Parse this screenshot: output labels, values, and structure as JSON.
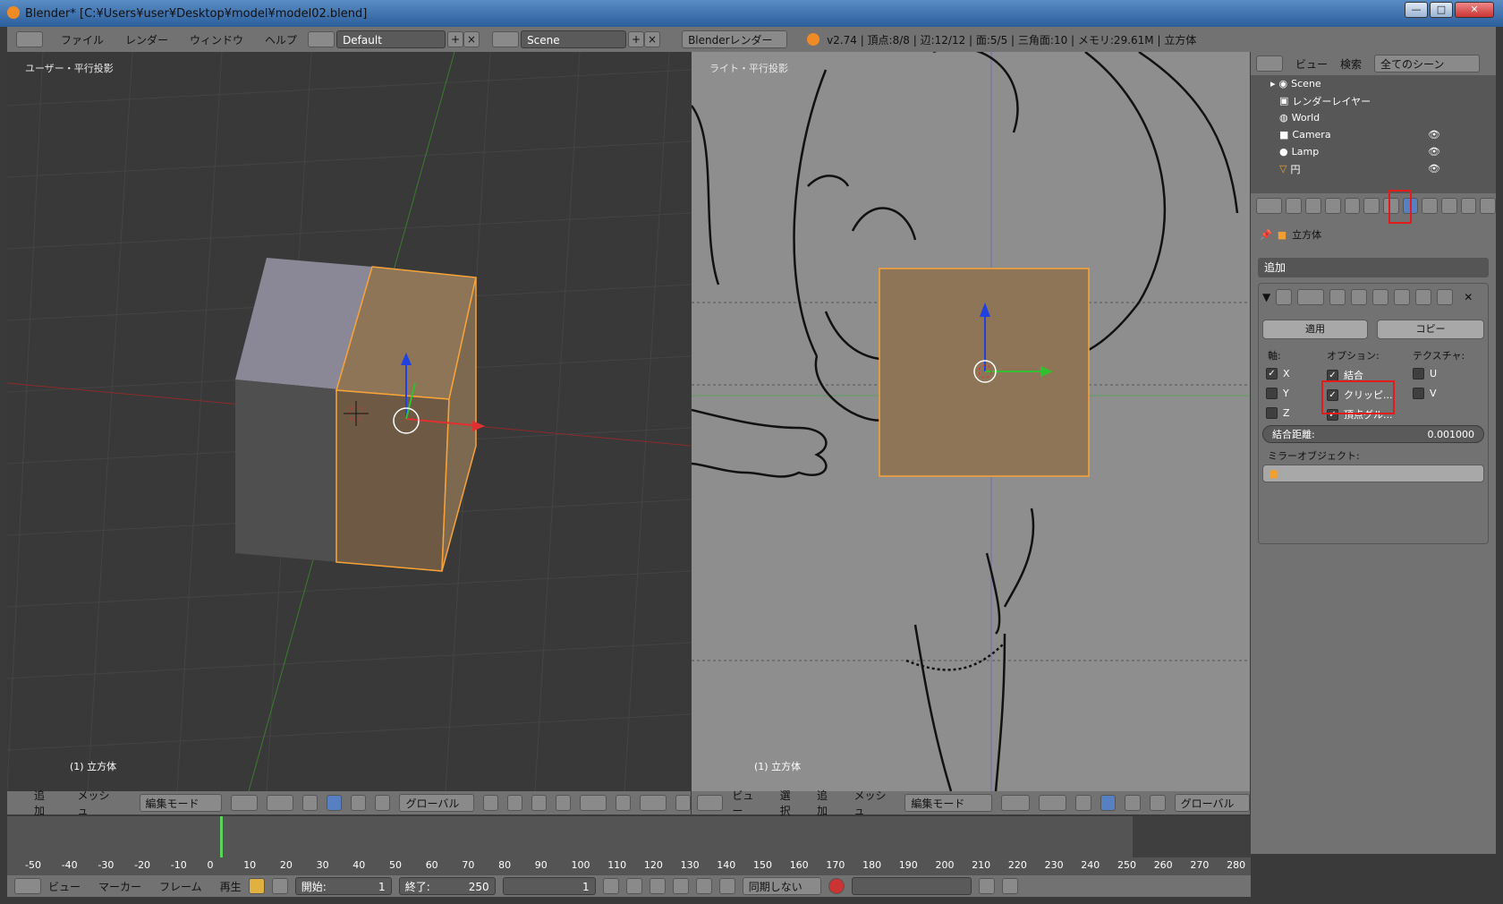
{
  "window": {
    "title": "Blender* [C:¥Users¥user¥Desktop¥model¥model02.blend]",
    "controls": [
      "—",
      "□",
      "✕"
    ]
  },
  "info_header": {
    "menus": [
      "ファイル",
      "レンダー",
      "ウィンドウ",
      "ヘルプ"
    ],
    "layout": "Default",
    "scene": "Scene",
    "engine": "Blenderレンダー",
    "stats": "v2.74 | 頂点:8/8 | 辺:12/12 | 面:5/5 | 三角面:10 | メモリ:29.61M | 立方体"
  },
  "viewport_left": {
    "label": "ユーザー・平行投影",
    "object": "(1) 立方体",
    "header": {
      "menus": [
        "追加",
        "メッシュ"
      ],
      "mode": "編集モード",
      "orientation": "グローバル"
    }
  },
  "viewport_right": {
    "label": "ライト・平行投影",
    "object": "(1) 立方体",
    "header": {
      "menus": [
        "ビュー",
        "選択",
        "追加",
        "メッシュ"
      ],
      "mode": "編集モード",
      "orientation": "グローバル"
    }
  },
  "outliner": {
    "menus": [
      "ビュー",
      "検索"
    ],
    "filter": "全てのシーン",
    "items": [
      {
        "label": "Scene"
      },
      {
        "label": "レンダーレイヤー"
      },
      {
        "label": "World"
      },
      {
        "label": "Camera"
      },
      {
        "label": "Lamp"
      },
      {
        "label": "円"
      }
    ]
  },
  "properties": {
    "breadcrumb": "立方体",
    "add_modifier": "追加",
    "modifier": {
      "apply": "適用",
      "copy": "コピー",
      "axis_heading": "軸:",
      "options_heading": "オプション:",
      "texture_heading": "テクスチャ:",
      "axes": [
        {
          "label": "X",
          "checked": true
        },
        {
          "label": "Y",
          "checked": false
        },
        {
          "label": "Z",
          "checked": false
        }
      ],
      "options": [
        {
          "label": "結合",
          "checked": true
        },
        {
          "label": "クリッピ...",
          "checked": true
        },
        {
          "label": "頂点グル...",
          "checked": true
        }
      ],
      "textures": [
        {
          "label": "U",
          "checked": false
        },
        {
          "label": "V",
          "checked": false
        }
      ],
      "merge_label": "結合距離:",
      "merge_value": "0.001000",
      "mirror_object_label": "ミラーオブジェクト:"
    }
  },
  "timeline": {
    "ticks": [
      "-50",
      "-40",
      "-30",
      "-20",
      "-10",
      "0",
      "10",
      "20",
      "30",
      "40",
      "50",
      "60",
      "70",
      "80",
      "90",
      "100",
      "110",
      "120",
      "130",
      "140",
      "150",
      "160",
      "170",
      "180",
      "190",
      "200",
      "210",
      "220",
      "230",
      "240",
      "250",
      "260",
      "270",
      "280"
    ],
    "menus": [
      "ビュー",
      "マーカー",
      "フレーム",
      "再生"
    ],
    "start_label": "開始:",
    "start": "1",
    "end_label": "終了:",
    "end": "250",
    "current": "1",
    "sync": "同期しない"
  },
  "colors": {
    "selected_face": "#8f7558",
    "selection_edge": "#f7a338",
    "accent_red": "#e21b1b"
  }
}
